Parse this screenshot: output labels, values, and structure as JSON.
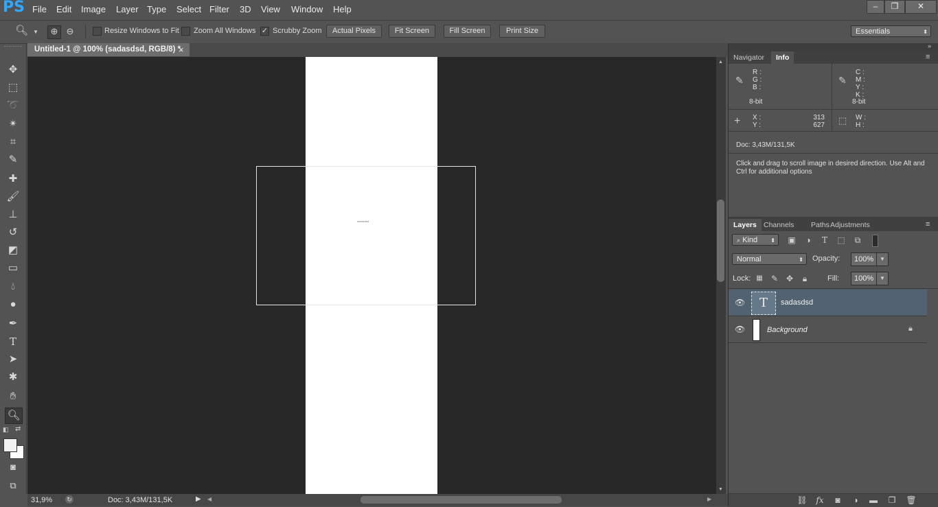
{
  "app": {
    "logo": "PS"
  },
  "menu": [
    "File",
    "Edit",
    "Image",
    "Layer",
    "Type",
    "Select",
    "Filter",
    "3D",
    "View",
    "Window",
    "Help"
  ],
  "window_buttons": {
    "minimize": "–",
    "restore": "❐",
    "close": "✕"
  },
  "options": {
    "resize_windows": "Resize Windows to Fit",
    "zoom_all": "Zoom All Windows",
    "scrubby_zoom": "Scrubby Zoom",
    "actual_pixels": "Actual Pixels",
    "fit_screen": "Fit Screen",
    "fill_screen": "Fill Screen",
    "print_size": "Print Size",
    "workspace": "Essentials",
    "checks": {
      "resize_windows": false,
      "zoom_all": false,
      "scrubby_zoom": true
    }
  },
  "document": {
    "tab_title": "Untitled-1 @ 100% (sadasdsd, RGB/8) *",
    "close": "×",
    "canvas_text": "sadasdsd"
  },
  "status": {
    "zoom": "31,9%",
    "doc": "Doc: 3,43M/131,5K"
  },
  "info_panel": {
    "tabs": [
      "Navigator",
      "Info"
    ],
    "active_tab": "Info",
    "rgb_labels": [
      "R :",
      "G :",
      "B :"
    ],
    "cmyk_labels": [
      "C :",
      "M :",
      "Y :",
      "K :"
    ],
    "bit_left": "8-bit",
    "bit_right": "8-bit",
    "x_label": "X :",
    "y_label": "Y :",
    "x_value": "313",
    "y_value": "627",
    "w_label": "W :",
    "h_label": "H :",
    "doc": "Doc: 3,43M/131,5K",
    "hint": "Click and drag to scroll image in desired direction.  Use Alt and Ctrl for additional options"
  },
  "layers_panel": {
    "tabs": [
      "Layers",
      "Channels",
      "Paths",
      "Adjustments"
    ],
    "active_tab": "Layers",
    "kind": "Kind",
    "blend_mode": "Normal",
    "opacity_label": "Opacity:",
    "opacity": "100%",
    "lock_label": "Lock:",
    "fill_label": "Fill:",
    "fill": "100%",
    "layers": [
      {
        "name": "sadasdsd",
        "type": "text",
        "selected": true
      },
      {
        "name": "Background",
        "type": "background",
        "locked": true
      }
    ]
  },
  "colors": {
    "accent": "#31a8ff",
    "selected_layer": "#536270"
  }
}
